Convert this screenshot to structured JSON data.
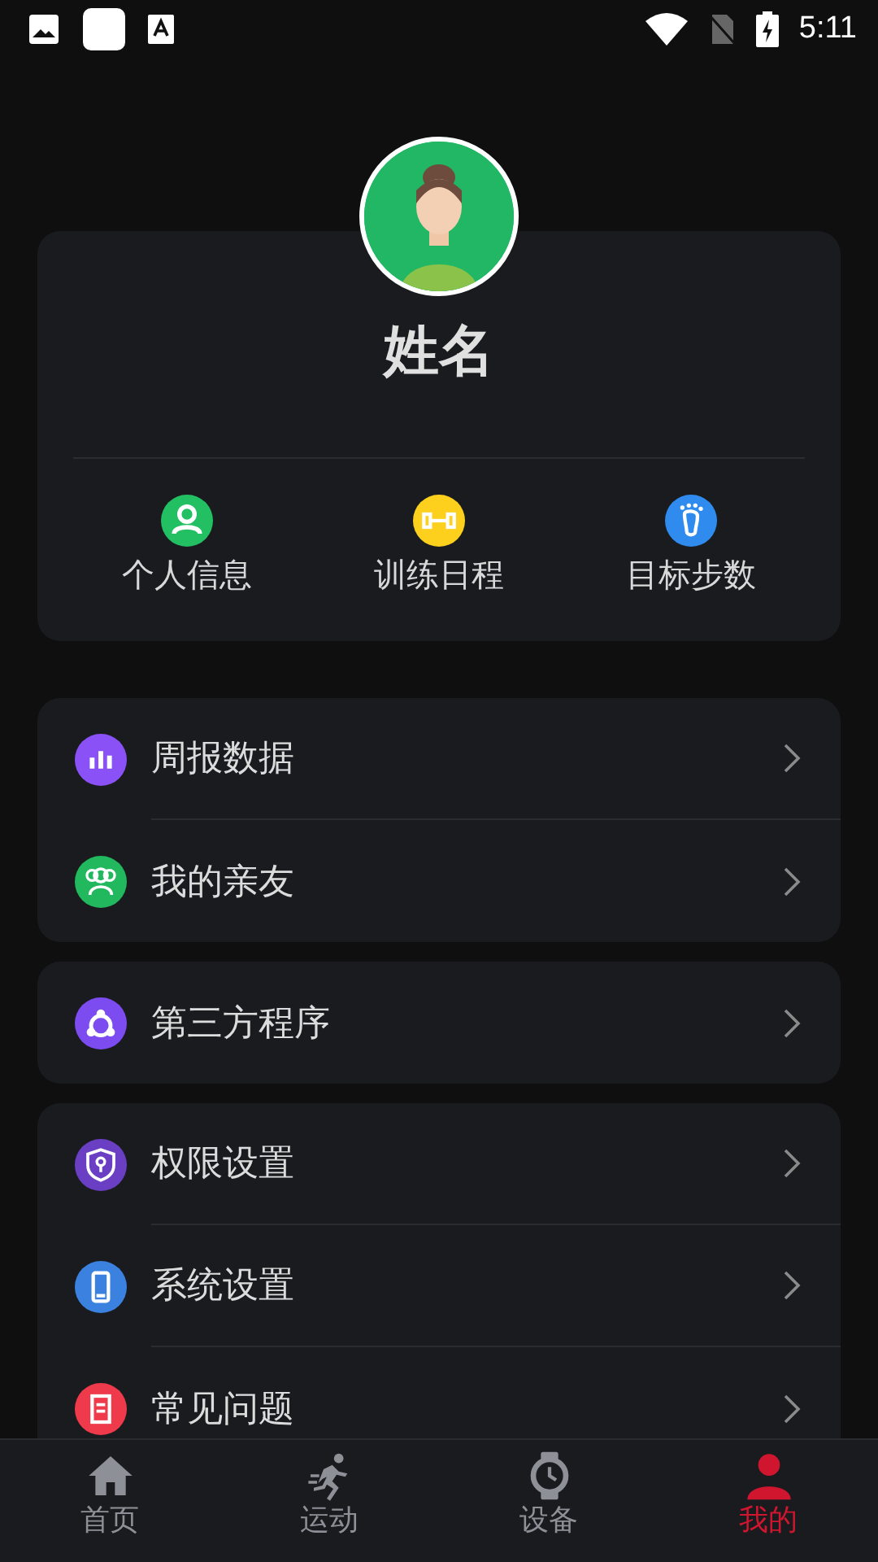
{
  "status_bar": {
    "time": "5:11"
  },
  "profile": {
    "name": "姓名",
    "shortcuts": [
      {
        "label": "个人信息",
        "kind": "person",
        "color": "#22c063"
      },
      {
        "label": "训练日程",
        "kind": "dumbbell",
        "color": "#fdd01e"
      },
      {
        "label": "目标步数",
        "kind": "foot",
        "color": "#2f8cee"
      }
    ]
  },
  "menu_groups": [
    {
      "items": [
        {
          "label": "周报数据",
          "kind": "chart",
          "color": "#8a52f6"
        },
        {
          "label": "我的亲友",
          "kind": "people",
          "color": "#22b85e"
        }
      ]
    },
    {
      "items": [
        {
          "label": "第三方程序",
          "kind": "nodes",
          "color": "#7d4cf0"
        }
      ]
    },
    {
      "items": [
        {
          "label": "权限设置",
          "kind": "shield",
          "color": "#6a3fc4"
        },
        {
          "label": "系统设置",
          "kind": "phone",
          "color": "#3b82e0"
        },
        {
          "label": "常见问题",
          "kind": "doc",
          "color": "#ef3a4c"
        }
      ]
    }
  ],
  "tab_bar": {
    "tabs": [
      {
        "label": "首页",
        "kind": "home",
        "selected": false
      },
      {
        "label": "运动",
        "kind": "run",
        "selected": false
      },
      {
        "label": "设备",
        "kind": "watch",
        "selected": false
      },
      {
        "label": "我的",
        "kind": "user",
        "selected": true
      }
    ]
  }
}
